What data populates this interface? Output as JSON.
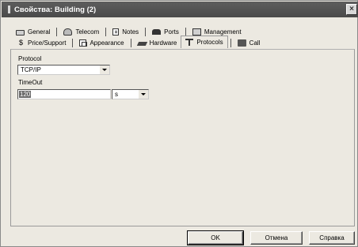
{
  "window": {
    "title": "Свойства: Building (2)",
    "close_glyph": "×"
  },
  "tabs": {
    "row1": [
      {
        "label": "General",
        "icon": "general-icon"
      },
      {
        "label": "Telecom",
        "icon": "telecom-icon"
      },
      {
        "label": "Notes",
        "icon": "notes-icon"
      },
      {
        "label": "Ports",
        "icon": "ports-icon"
      },
      {
        "label": "Management",
        "icon": "management-icon"
      }
    ],
    "row2": [
      {
        "label": "Price/Support",
        "icon": "price-icon"
      },
      {
        "label": "Appearance",
        "icon": "appearance-icon"
      },
      {
        "label": "Hardware",
        "icon": "hardware-icon"
      },
      {
        "label": "Protocols",
        "icon": "protocols-icon",
        "active": true
      },
      {
        "label": "Call",
        "icon": "call-icon"
      }
    ]
  },
  "form": {
    "protocol_label": "Protocol",
    "protocol_value": "TCP/IP",
    "timeout_label": "TimeOut",
    "timeout_value": "120",
    "timeout_unit": "s"
  },
  "buttons": {
    "ok": "OK",
    "cancel": "Отмена",
    "help": "Справка"
  }
}
